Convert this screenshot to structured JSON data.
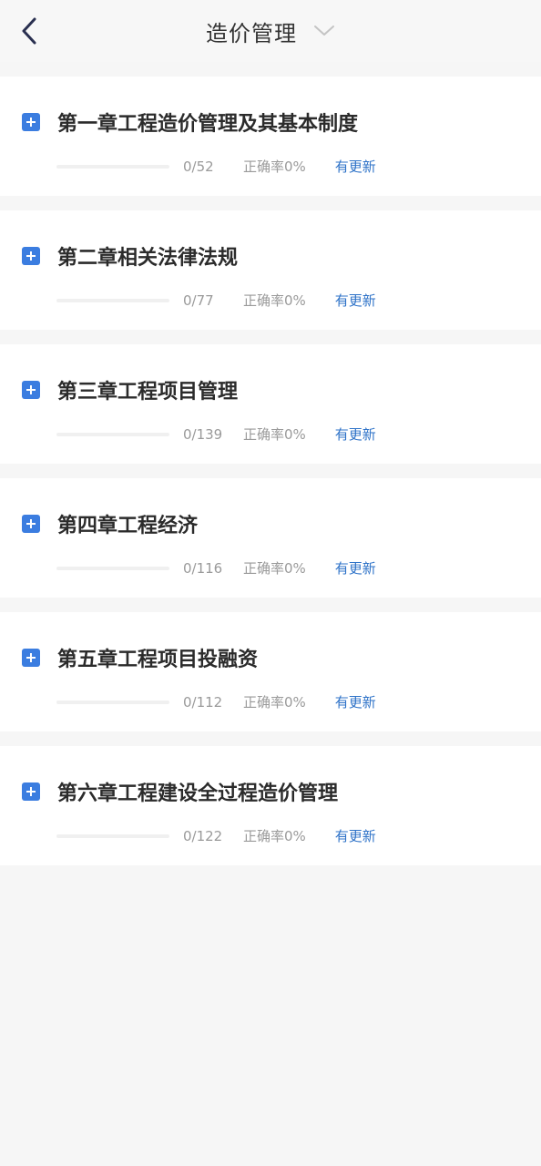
{
  "header": {
    "title": "造价管理",
    "back_icon": "chevron-left-icon",
    "dropdown_icon": "chevron-down-icon"
  },
  "colors": {
    "accent": "#3b7de0",
    "link": "#2f73c8",
    "background": "#f6f6f6"
  },
  "chapters": [
    {
      "title": "第一章工程造价管理及其基本制度",
      "count": "0/52",
      "accuracy": "正确率0%",
      "update": "有更新",
      "progress": 0
    },
    {
      "title": "第二章相关法律法规",
      "count": "0/77",
      "accuracy": "正确率0%",
      "update": "有更新",
      "progress": 0
    },
    {
      "title": "第三章工程项目管理",
      "count": "0/139",
      "accuracy": "正确率0%",
      "update": "有更新",
      "progress": 0
    },
    {
      "title": "第四章工程经济",
      "count": "0/116",
      "accuracy": "正确率0%",
      "update": "有更新",
      "progress": 0
    },
    {
      "title": "第五章工程项目投融资",
      "count": "0/112",
      "accuracy": "正确率0%",
      "update": "有更新",
      "progress": 0
    },
    {
      "title": "第六章工程建设全过程造价管理",
      "count": "0/122",
      "accuracy": "正确率0%",
      "update": "有更新",
      "progress": 0
    }
  ]
}
